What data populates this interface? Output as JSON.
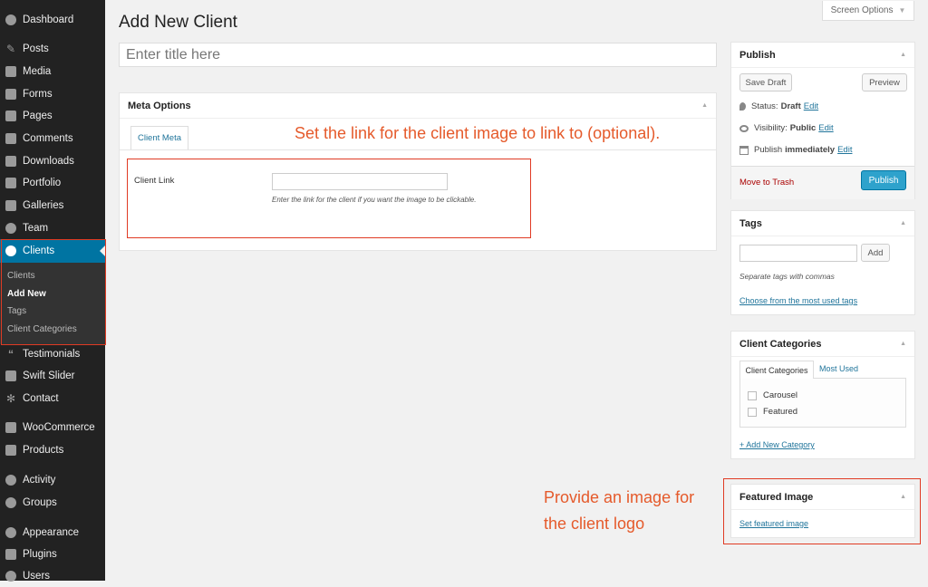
{
  "sidebar": {
    "items": [
      {
        "label": "Dashboard",
        "icon": "dashboard-icon"
      },
      {
        "label": "Posts",
        "icon": "pin-icon"
      },
      {
        "label": "Media",
        "icon": "media-icon"
      },
      {
        "label": "Forms",
        "icon": "forms-icon"
      },
      {
        "label": "Pages",
        "icon": "pages-icon"
      },
      {
        "label": "Comments",
        "icon": "comments-icon"
      },
      {
        "label": "Downloads",
        "icon": "downloads-icon"
      },
      {
        "label": "Portfolio",
        "icon": "portfolio-icon"
      },
      {
        "label": "Galleries",
        "icon": "galleries-icon"
      },
      {
        "label": "Team",
        "icon": "team-icon"
      },
      {
        "label": "Clients",
        "icon": "clients-icon"
      },
      {
        "label": "Testimonials",
        "icon": "quote-icon"
      },
      {
        "label": "Swift Slider",
        "icon": "slider-icon"
      },
      {
        "label": "Contact",
        "icon": "gear-icon"
      },
      {
        "label": "WooCommerce",
        "icon": "woocommerce-icon"
      },
      {
        "label": "Products",
        "icon": "cart-icon"
      },
      {
        "label": "Activity",
        "icon": "activity-icon"
      },
      {
        "label": "Groups",
        "icon": "groups-icon"
      },
      {
        "label": "Appearance",
        "icon": "appearance-icon"
      },
      {
        "label": "Plugins",
        "icon": "plugins-icon"
      },
      {
        "label": "Users",
        "icon": "users-icon"
      }
    ],
    "clients_submenu": [
      "Clients",
      "Add New",
      "Tags",
      "Client Categories"
    ],
    "active_color": "#0074a2"
  },
  "header": {
    "page_title": "Add New Client",
    "screen_options": "Screen Options"
  },
  "title_field": {
    "placeholder": "Enter title here"
  },
  "meta_options": {
    "title": "Meta Options",
    "tab": "Client Meta",
    "client_link_label": "Client Link",
    "client_link_value": "",
    "client_link_desc": "Enter the link for the client if you want the image to be clickable."
  },
  "publish": {
    "title": "Publish",
    "save_draft": "Save Draft",
    "preview": "Preview",
    "status_label": "Status:",
    "status_value": "Draft",
    "visibility_label": "Visibility:",
    "visibility_value": "Public",
    "publish_label": "Publish",
    "publish_value": "immediately",
    "edit": "Edit",
    "trash": "Move to Trash",
    "publish_button": "Publish",
    "button_color": "#2ea2cc"
  },
  "tags": {
    "title": "Tags",
    "add": "Add",
    "help": "Separate tags with commas",
    "cloud_link": "Choose from the most used tags"
  },
  "client_categories": {
    "title": "Client Categories",
    "tab_all": "Client Categories",
    "tab_popular": "Most Used",
    "items": [
      "Carousel",
      "Featured"
    ],
    "add_link": "+ Add New Category"
  },
  "featured_image": {
    "title": "Featured Image",
    "set_link": "Set featured image"
  },
  "annotations": {
    "client_link": "Set the link for the client image to link to (optional).",
    "image_line1": "Provide an image for",
    "image_line2": "the client logo",
    "highlight_color": "#e03b24"
  }
}
